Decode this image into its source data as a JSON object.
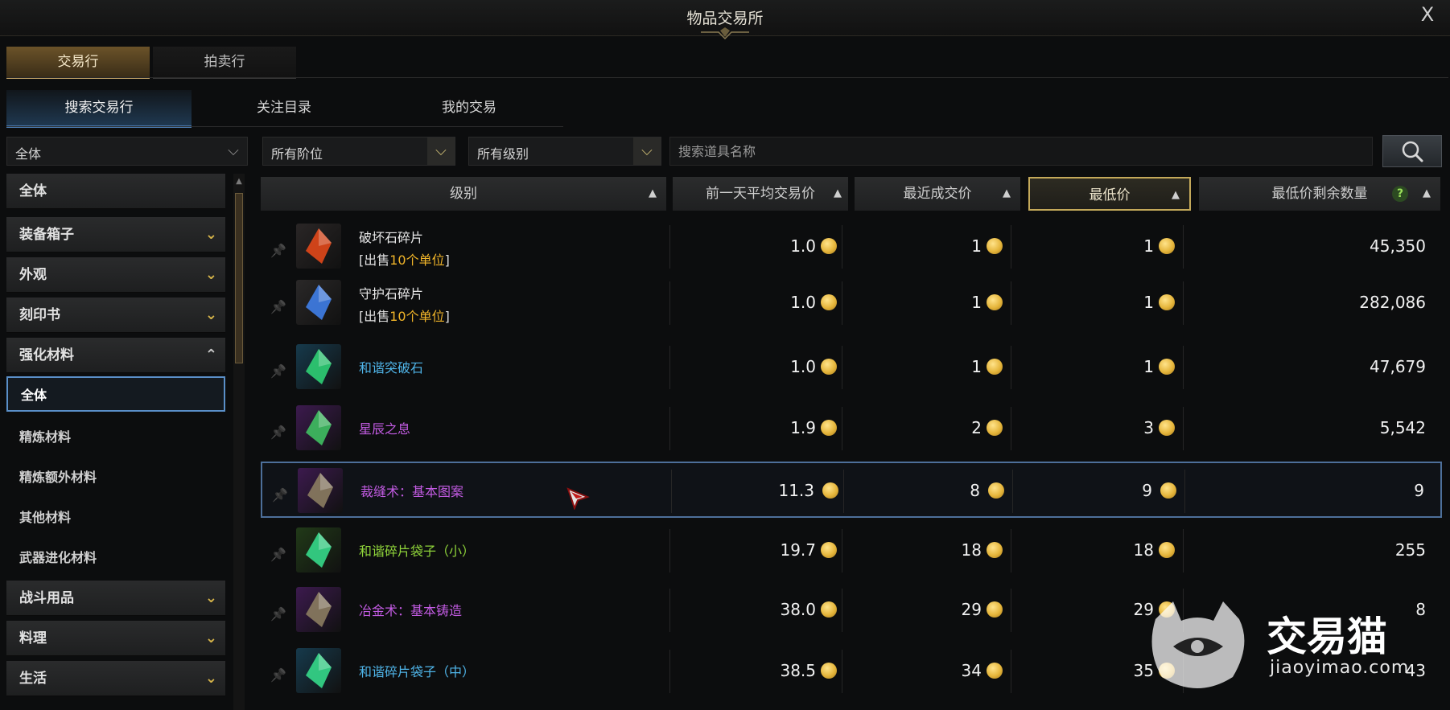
{
  "window": {
    "title": "物品交易所",
    "close_label": "X"
  },
  "main_tabs": [
    {
      "label": "交易行",
      "active": true
    },
    {
      "label": "拍卖行",
      "active": false
    }
  ],
  "sub_tabs": [
    {
      "label": "搜索交易行",
      "active": true
    },
    {
      "label": "关注目录",
      "active": false
    },
    {
      "label": "我的交易",
      "active": false
    }
  ],
  "filters": {
    "category": {
      "value": "全体"
    },
    "tier": {
      "value": "所有阶位"
    },
    "level": {
      "value": "所有级别"
    },
    "search": {
      "placeholder": "搜索道具名称",
      "value": ""
    }
  },
  "sidebar": {
    "items": [
      {
        "label": "全体",
        "kind": "category"
      },
      {
        "label": "装备箱子",
        "kind": "category",
        "chevron": "down"
      },
      {
        "label": "外观",
        "kind": "category",
        "chevron": "down"
      },
      {
        "label": "刻印书",
        "kind": "category",
        "chevron": "down"
      },
      {
        "label": "强化材料",
        "kind": "category",
        "chevron": "up"
      },
      {
        "label": "全体",
        "kind": "sub",
        "selected": true
      },
      {
        "label": "精炼材料",
        "kind": "sub"
      },
      {
        "label": "精炼额外材料",
        "kind": "sub"
      },
      {
        "label": "其他材料",
        "kind": "sub"
      },
      {
        "label": "武器进化材料",
        "kind": "sub"
      },
      {
        "label": "战斗用品",
        "kind": "category",
        "chevron": "down"
      },
      {
        "label": "料理",
        "kind": "category",
        "chevron": "down"
      },
      {
        "label": "生活",
        "kind": "category",
        "chevron": "down"
      }
    ]
  },
  "table": {
    "headers": {
      "level": "级别",
      "avg": "前一天平均交易价",
      "recent": "最近成交价",
      "low": "最低价",
      "qty": "最低价剩余数量",
      "help": "?"
    },
    "rows": [
      {
        "name": "破坏石碎片",
        "name_color": "#e9e9e9",
        "sub_pre": "[出售",
        "sub_hl": "10个单位",
        "sub_post": "]",
        "avg": "1.0",
        "recent": "1",
        "low": "1",
        "qty": "45,350",
        "icon": "red-crystal-shard-icon",
        "icon_bg": "#2a2626",
        "icon_fg": "#e2481a"
      },
      {
        "name": "守护石碎片",
        "name_color": "#e9e9e9",
        "sub_pre": "[出售",
        "sub_hl": "10个单位",
        "sub_post": "]",
        "avg": "1.0",
        "recent": "1",
        "low": "1",
        "qty": "282,086",
        "icon": "blue-crystal-shard-icon",
        "icon_bg": "#2a2828",
        "icon_fg": "#3f7ee8"
      },
      {
        "name": "和谐突破石",
        "name_color": "#4fb4e8",
        "sub_pre": "",
        "sub_hl": "",
        "sub_post": "",
        "avg": "1.0",
        "recent": "1",
        "low": "1",
        "qty": "47,679",
        "icon": "green-gem-icon",
        "icon_bg": "#163a4c",
        "icon_fg": "#2fcf74"
      },
      {
        "name": "星辰之息",
        "name_color": "#c25be2",
        "sub_pre": "",
        "sub_hl": "",
        "sub_post": "",
        "avg": "1.9",
        "recent": "2",
        "low": "3",
        "qty": "5,542",
        "icon": "star-orb-icon",
        "icon_bg": "#3c1a4e",
        "icon_fg": "#3fbf62"
      },
      {
        "name": "裁缝术：基本图案",
        "name_color": "#c25be2",
        "sub_pre": "",
        "sub_hl": "",
        "sub_post": "",
        "avg": "11.3",
        "recent": "8",
        "low": "9",
        "qty": "9",
        "icon": "book-icon",
        "icon_bg": "#3c1a4e",
        "icon_fg": "#8b7c60",
        "selected": true
      },
      {
        "name": "和谐碎片袋子（小）",
        "name_color": "#8fd43a",
        "sub_pre": "",
        "sub_hl": "",
        "sub_post": "",
        "avg": "19.7",
        "recent": "18",
        "low": "18",
        "qty": "255",
        "icon": "shard-pouch-icon",
        "icon_bg": "#213a18",
        "icon_fg": "#35d88a"
      },
      {
        "name": "冶金术：基本铸造",
        "name_color": "#c25be2",
        "sub_pre": "",
        "sub_hl": "",
        "sub_post": "",
        "avg": "38.0",
        "recent": "29",
        "low": "29",
        "qty": "8",
        "icon": "book-icon",
        "icon_bg": "#3c1a4e",
        "icon_fg": "#8b7c60"
      },
      {
        "name": "和谐碎片袋子（中）",
        "name_color": "#4fb4e8",
        "sub_pre": "",
        "sub_hl": "",
        "sub_post": "",
        "avg": "38.5",
        "recent": "34",
        "low": "35",
        "qty": "43",
        "icon": "shard-pouch-icon",
        "icon_bg": "#163a4c",
        "icon_fg": "#35d88a"
      }
    ]
  },
  "watermark": {
    "brand": "交易猫",
    "url": "jiaoyimao.com"
  },
  "colors": {
    "accent_gold": "#c9a868",
    "accent_blue": "#4a7ab0",
    "rare_purple": "#c25be2",
    "rare_blue": "#4fb4e8",
    "uncommon_green": "#8fd43a"
  }
}
